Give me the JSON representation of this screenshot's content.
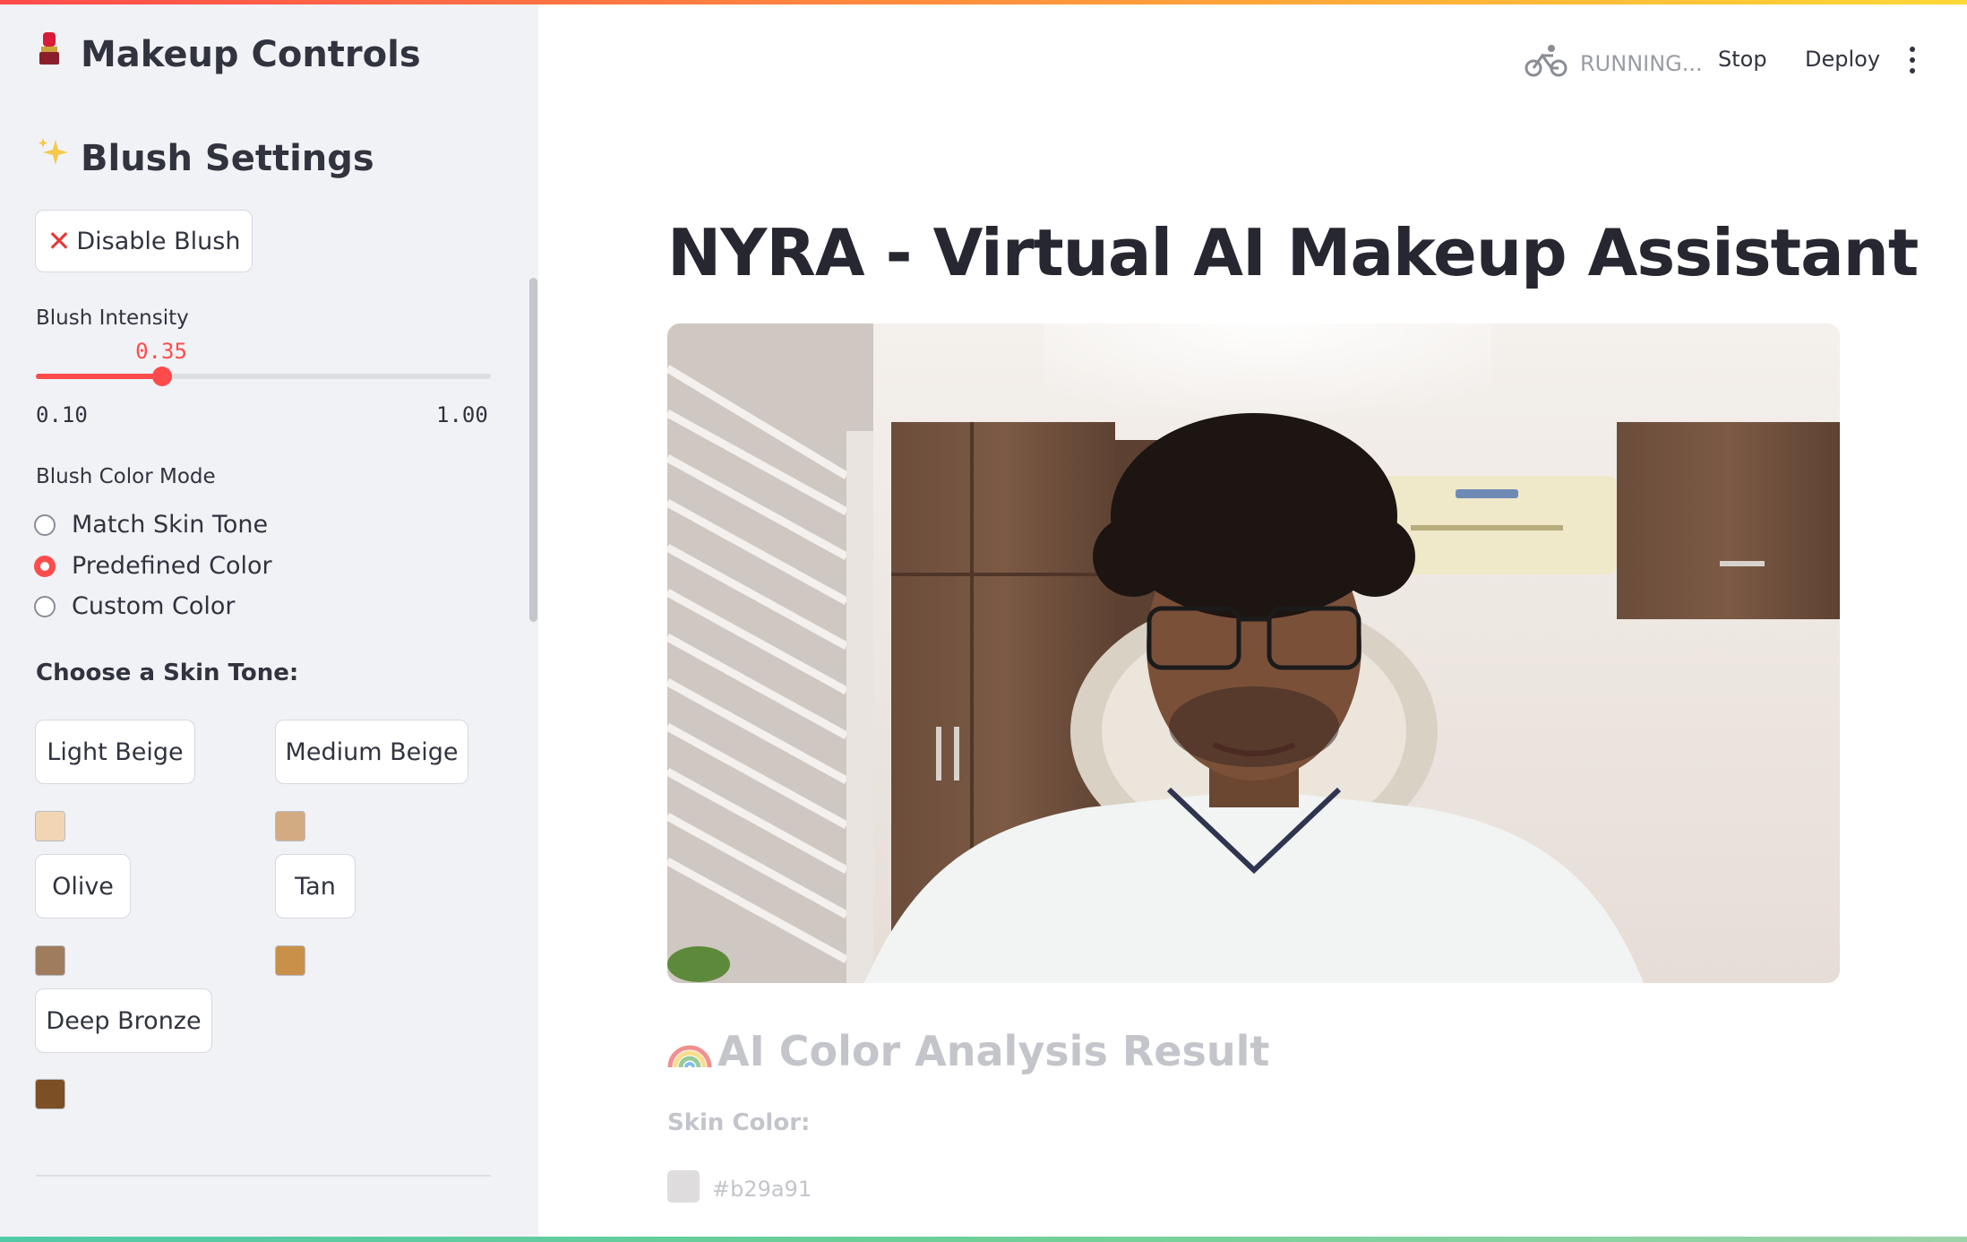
{
  "sidebar": {
    "title": "Makeup Controls",
    "title_icon": "lipstick-icon",
    "section_title": "Blush Settings",
    "section_icon": "sparkles-icon",
    "disable_button": "Disable Blush",
    "intensity": {
      "label": "Blush Intensity",
      "value_text": "0.35",
      "value": 0.35,
      "min_text": "0.10",
      "max_text": "1.00",
      "min": 0.1,
      "max": 1.0
    },
    "color_mode": {
      "label": "Blush Color Mode",
      "options": [
        "Match Skin Tone",
        "Predefined Color",
        "Custom Color"
      ],
      "selected": "Predefined Color"
    },
    "skin_tone_label": "Choose a Skin Tone:",
    "skin_tones": [
      {
        "label": "Light Beige",
        "color": "#f2d5b5"
      },
      {
        "label": "Medium Beige",
        "color": "#d3ab82"
      },
      {
        "label": "Olive",
        "color": "#9e7c5d"
      },
      {
        "label": "Tan",
        "color": "#c99049"
      },
      {
        "label": "Deep Bronze",
        "color": "#7c4f24"
      }
    ]
  },
  "header": {
    "status": "RUNNING...",
    "status_icon": "bicycle-icon",
    "stop": "Stop",
    "deploy": "Deploy",
    "menu_icon": "more-vertical-icon"
  },
  "main": {
    "title": "NYRA - Virtual AI Makeup Assistant",
    "video_alt": "webcam-feed",
    "analysis_title": "AI Color Analysis Result",
    "analysis_icon": "rainbow-icon",
    "skin_color_label": "Skin Color:",
    "skin_color_hex": "#b29a91"
  },
  "colors": {
    "accent": "#ff4b4b",
    "sidebar_bg": "#f0f2f6"
  }
}
